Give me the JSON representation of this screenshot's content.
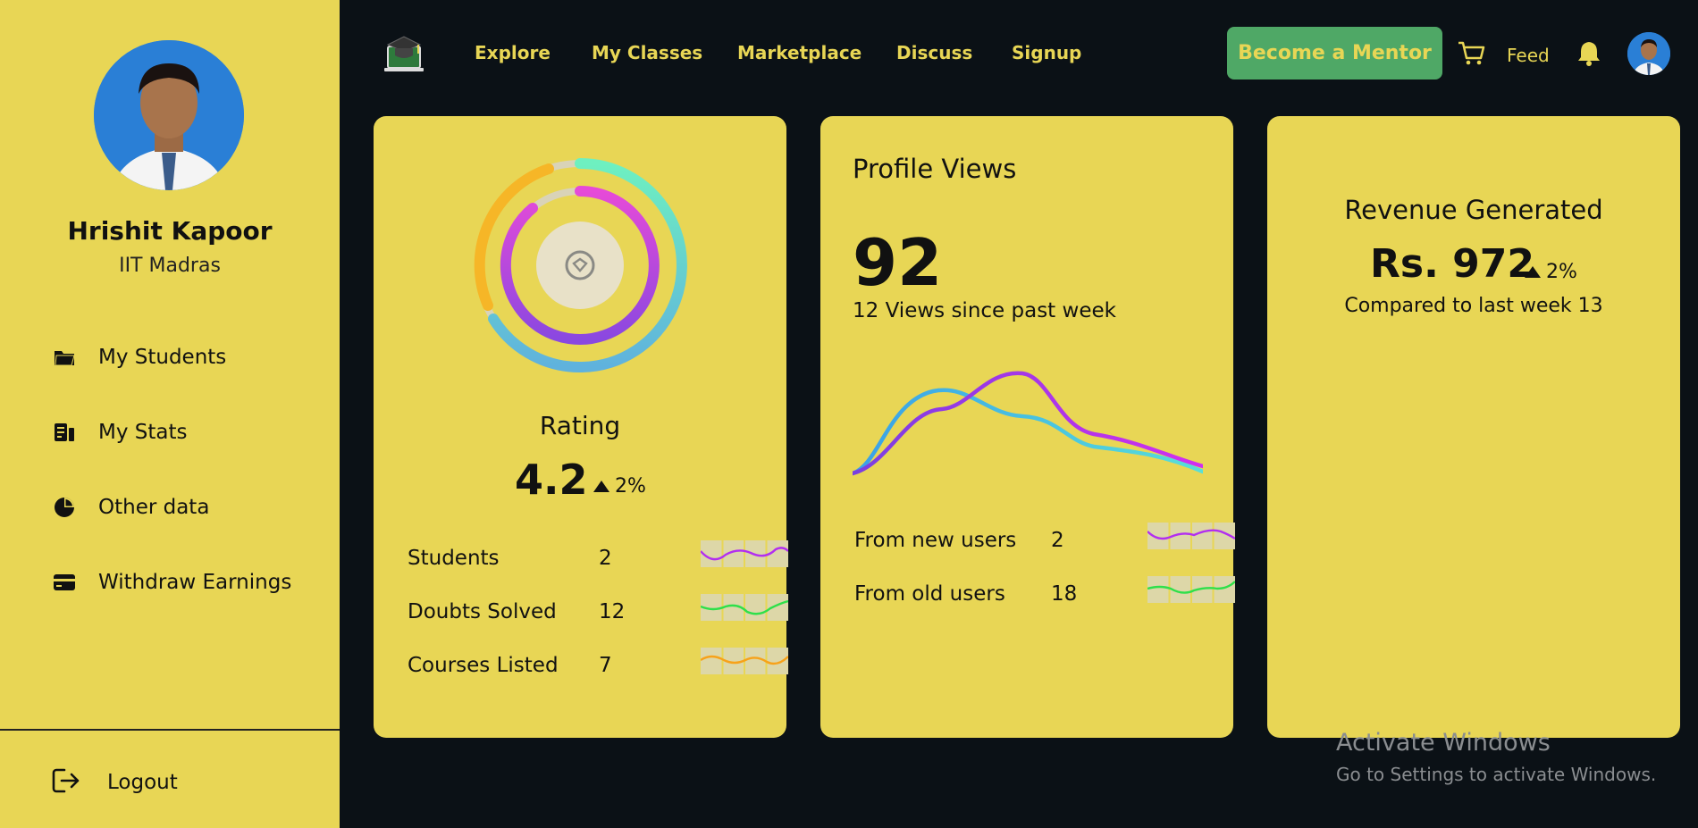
{
  "sidebar": {
    "profile": {
      "name": "Hrishit Kapoor",
      "institute": "IIT Madras"
    },
    "items": [
      {
        "label": "My Students",
        "icon": "folder-icon"
      },
      {
        "label": "My Stats",
        "icon": "stats-icon"
      },
      {
        "label": "Other data",
        "icon": "pie-chart-icon"
      },
      {
        "label": "Withdraw Earnings",
        "icon": "credit-card-icon"
      }
    ],
    "logout_label": "Logout"
  },
  "nav": {
    "links": [
      "Explore",
      "My Classes",
      "Marketplace",
      "Discuss",
      "Signup"
    ],
    "mentor_button": "Become a Mentor",
    "feed_label": "Feed"
  },
  "rating_card": {
    "label": "Rating",
    "value": "4.2",
    "change": "2%",
    "stats": [
      {
        "label": "Students",
        "value": "2",
        "color": "#b22ef0"
      },
      {
        "label": "Doubts Solved",
        "value": "12",
        "color": "#2ee04a"
      },
      {
        "label": "Courses Listed",
        "value": "7",
        "color": "#f7a21a"
      }
    ]
  },
  "views_card": {
    "title": "Profile Views",
    "value": "92",
    "subtitle": "12 Views since past week",
    "sources": [
      {
        "label": "From new users",
        "value": "2",
        "color": "#b22ef0"
      },
      {
        "label": "From old users",
        "value": "18",
        "color": "#2ee04a"
      }
    ]
  },
  "revenue_card": {
    "title": "Revenue Generated",
    "value": "Rs. 972",
    "change": "2%",
    "subtitle": "Compared to last week 13"
  },
  "watermark": {
    "title": "Activate Windows",
    "subtitle": "Go to Settings to activate Windows."
  },
  "colors": {
    "sidebar_bg": "#e8d655",
    "page_bg": "#0b1116",
    "accent_green": "#4fa866"
  }
}
